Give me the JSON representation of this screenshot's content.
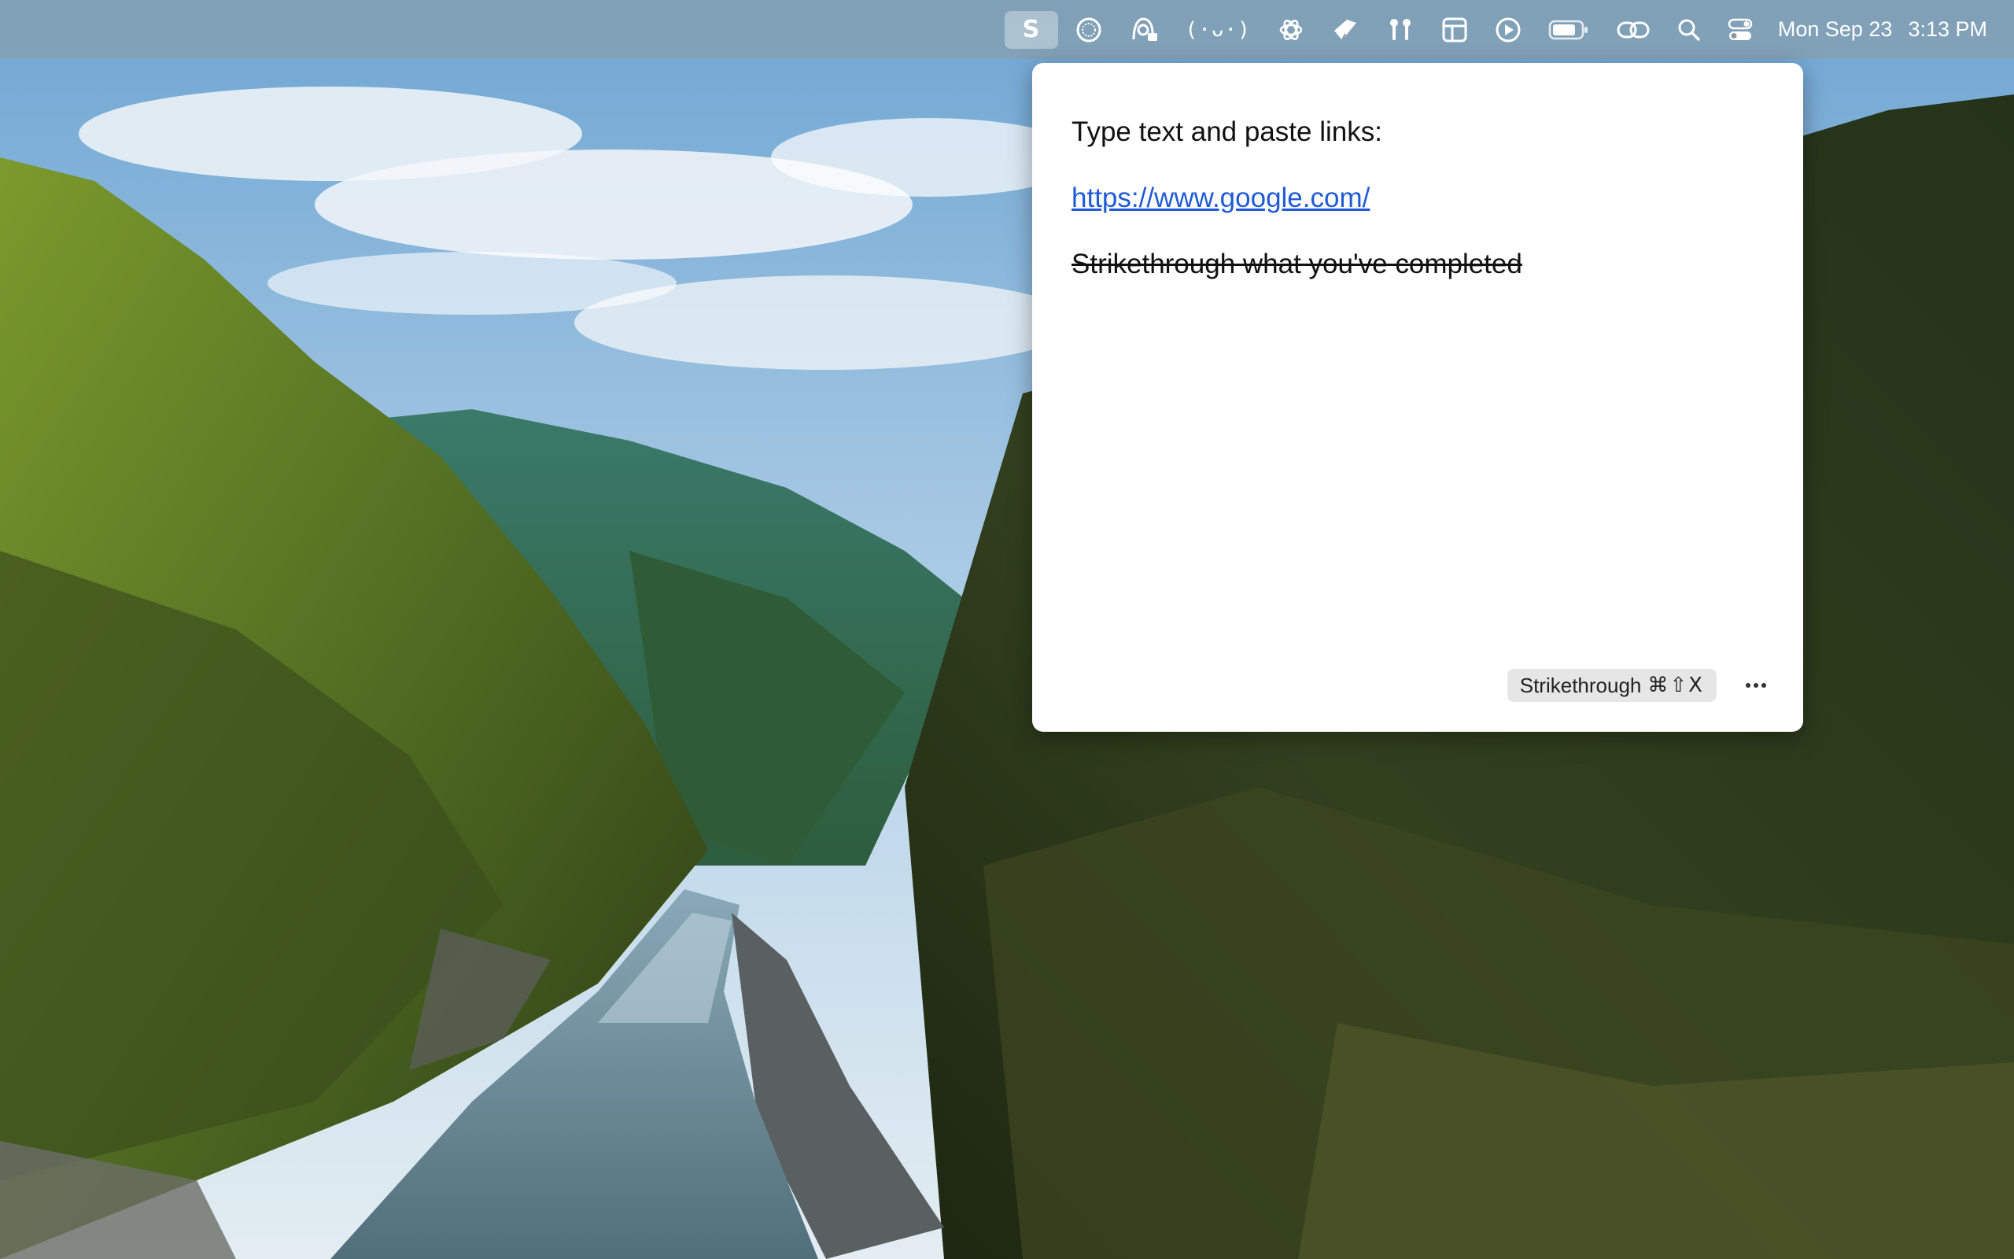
{
  "menubar": {
    "active_app_letter": "S",
    "icons": [
      "s-app-icon",
      "globe-icon",
      "hand-lock-icon",
      "face-glyph-icon",
      "openai-icon",
      "brush-icon",
      "airpods-icon",
      "layout-icon",
      "play-icon",
      "battery-icon",
      "link-icon",
      "search-icon",
      "control-center-icon"
    ],
    "face_glyph": "(·ᴗ·)",
    "date": "Mon Sep 23",
    "time": "3:13 PM"
  },
  "popover": {
    "lines": {
      "intro": "Type text and paste links:",
      "link": "https://www.google.com/",
      "strike": "Strikethrough what you've completed"
    },
    "shortcut": {
      "label": "Strikethrough",
      "keys": "⌘⇧X"
    },
    "more_label": "···"
  },
  "colors": {
    "link": "#1f5bd6",
    "chip_bg": "#e6e6e6",
    "popover_bg": "#ffffff"
  }
}
